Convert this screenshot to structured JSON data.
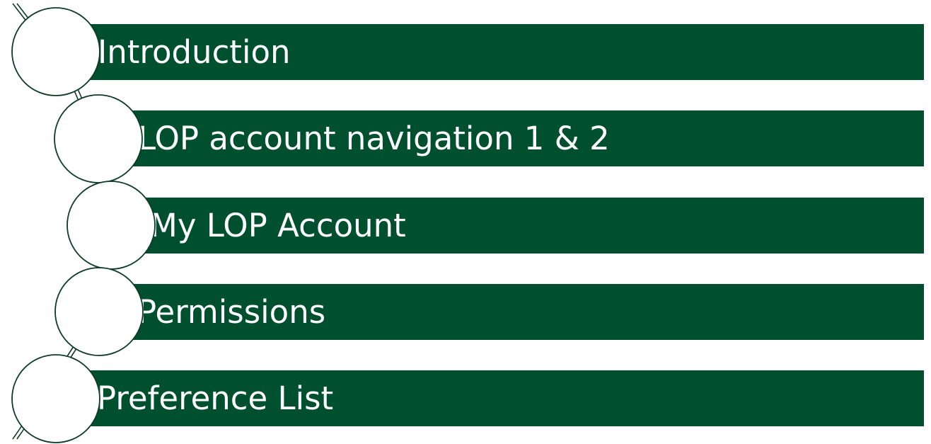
{
  "diagram": {
    "items": [
      {
        "label": "Introduction"
      },
      {
        "label": "LOP account navigation 1 & 2"
      },
      {
        "label": "My LOP Account"
      },
      {
        "label": "Permissions"
      },
      {
        "label": "Preference List"
      }
    ]
  },
  "colors": {
    "bar": "#005030",
    "bar_text": "#ffffff",
    "circle_fill": "#ffffff",
    "outline": "#005030"
  }
}
